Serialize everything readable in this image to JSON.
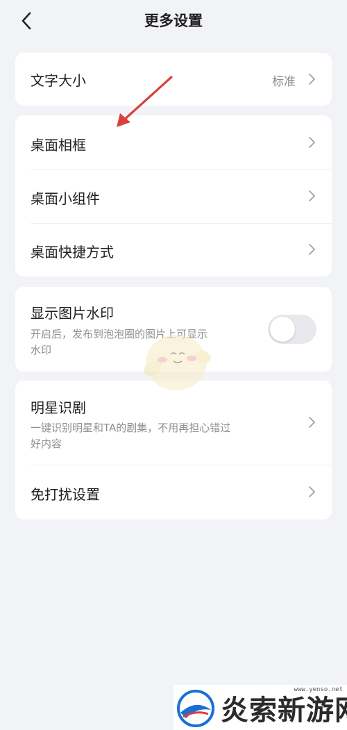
{
  "header": {
    "title": "更多设置",
    "back_icon": "chevron-left-icon"
  },
  "card_font": {
    "label": "文字大小",
    "value": "标准"
  },
  "card_desktop": {
    "items": [
      {
        "label": "桌面相框"
      },
      {
        "label": "桌面小组件"
      },
      {
        "label": "桌面快捷方式"
      }
    ]
  },
  "card_watermark": {
    "label": "显示图片水印",
    "desc_line1": "开启后，发布到泡泡圈的图片上可显示",
    "desc_line2": "水印",
    "toggle_on": false
  },
  "card_star": {
    "label": "明星识剧",
    "desc_line1": "一键识别明星和TA的剧集，不用再担心错过",
    "desc_line2": "好内容",
    "dnd_label": "免打扰设置"
  },
  "site_watermark": {
    "brand": "炎索新游网",
    "url": "www.yenso.net"
  },
  "colors": {
    "background": "#f2f3f7",
    "card": "#ffffff",
    "annotation_arrow": "#d9413a",
    "toggle_off": "#e9e9ed"
  }
}
